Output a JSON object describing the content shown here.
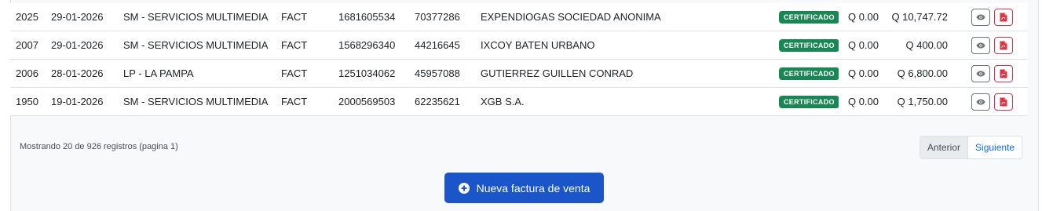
{
  "rows": [
    {
      "id": "2025",
      "date": "29-01-2026",
      "branch": "SM - SERVICIOS MULTIMEDIA",
      "doc_type": "FACT",
      "number": "1681605534",
      "nit": "70377286",
      "client": "EXPENDIOGAS SOCIEDAD ANONIMA",
      "status": "CERTIFICADO",
      "tax": "Q 0.00",
      "total": "Q 10,747.72"
    },
    {
      "id": "2007",
      "date": "29-01-2026",
      "branch": "SM - SERVICIOS MULTIMEDIA",
      "doc_type": "FACT",
      "number": "1568296340",
      "nit": "44216645",
      "client": "IXCOY BATEN URBANO",
      "status": "CERTIFICADO",
      "tax": "Q 0.00",
      "total": "Q 400.00"
    },
    {
      "id": "2006",
      "date": "28-01-2026",
      "branch": "LP - LA PAMPA",
      "doc_type": "FACT",
      "number": "1251034062",
      "nit": "45957088",
      "client": "GUTIERREZ GUILLEN CONRAD",
      "status": "CERTIFICADO",
      "tax": "Q 0.00",
      "total": "Q 6,800.00"
    },
    {
      "id": "1950",
      "date": "19-01-2026",
      "branch": "SM - SERVICIOS MULTIMEDIA",
      "doc_type": "FACT",
      "number": "2000569503",
      "nit": "62235621",
      "client": "XGB S.A.",
      "status": "CERTIFICADO",
      "tax": "Q 0.00",
      "total": "Q 1,750.00"
    }
  ],
  "actions": {
    "view_icon": "eye-icon",
    "pdf_icon": "file-pdf-icon"
  },
  "footer": {
    "summary": "Mostrando 20 de 926 registros (pagina 1)"
  },
  "pagination": {
    "prev_label": "Anterior",
    "next_label": "Siguiente"
  },
  "new_invoice": {
    "label": "Nueva factura de venta",
    "icon": "plus-circle-icon"
  },
  "colors": {
    "status_certified": "#198754",
    "primary_button": "#1a56c9",
    "pdf_accent": "#dc3545",
    "link": "#0d6efd"
  }
}
